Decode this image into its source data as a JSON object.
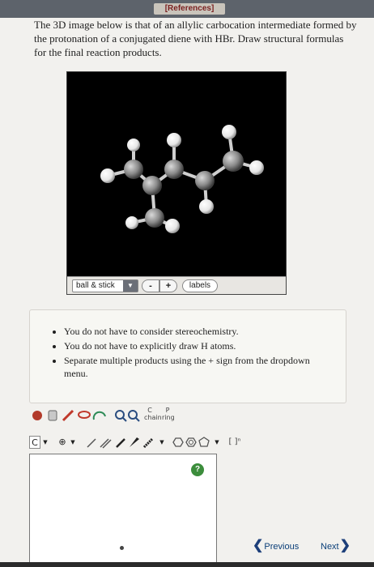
{
  "header": {
    "references_label": "[References]"
  },
  "question": {
    "text": "The 3D image below is that of an allylic carbocation intermediate formed by the protonation of a conjugated diene with HBr. Draw structural formulas for the final reaction products."
  },
  "viewer": {
    "style_value": "ball & stick",
    "zoom_out_label": "-",
    "zoom_in_label": "+",
    "labels_button": "labels"
  },
  "instructions": {
    "items": [
      "You do not have to consider stereochemistry.",
      "You do not have to explicitly draw H atoms.",
      "Separate multiple products using the + sign from the dropdown menu."
    ]
  },
  "toolbar": {
    "template_label": "C",
    "chain_label": "C\nchain",
    "ring_label": "P\nring",
    "bracket_label": "[ ]ⁿ"
  },
  "help": {
    "label": "?"
  },
  "nav": {
    "previous_label": "Previous",
    "next_label": "Next"
  },
  "colors": {
    "top_bar": "#5d636b",
    "help_green": "#3c8d3c",
    "nav_blue": "#0a3e78"
  }
}
